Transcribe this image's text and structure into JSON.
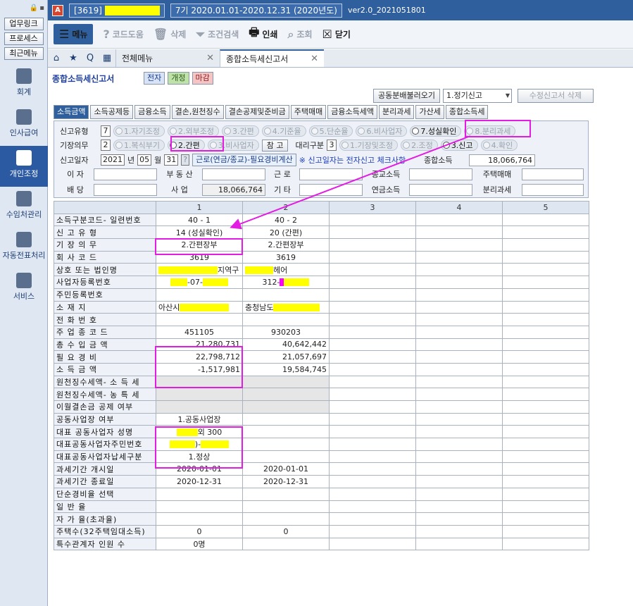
{
  "sidebar": {
    "quick": [
      "업무링크",
      "프로세스",
      "최근메뉴"
    ],
    "nav": [
      {
        "label": "회계",
        "icon": "calculator-icon",
        "active": false
      },
      {
        "label": "인사급여",
        "icon": "person-money-icon",
        "active": false
      },
      {
        "label": "개인조정",
        "icon": "person-icon",
        "active": true
      },
      {
        "label": "수임처관리",
        "icon": "building-icon",
        "active": false
      },
      {
        "label": "자동전표처리",
        "icon": "database-icon",
        "active": false
      },
      {
        "label": "서비스",
        "icon": "monitor-icon",
        "active": false
      }
    ]
  },
  "titlebar": {
    "company_code": "[3619]",
    "period": "7기 2020.01.01-2020.12.31 (2020년도)",
    "version": "ver2.0_2021051801"
  },
  "toolbar": {
    "menu": "메뉴",
    "help": "코드도움",
    "delete": "삭제",
    "search_condition": "조건검색",
    "print": "인쇄",
    "lookup": "조회",
    "close": "닫기"
  },
  "tabs": {
    "main_menu": "전체메뉴",
    "active": "종합소득세신고서"
  },
  "form": {
    "title": "종합소득세신고서",
    "badges": [
      "전자",
      "개정",
      "마감"
    ],
    "joint_button": "공동분배불러오기",
    "filing_select": "1.정기신고",
    "delete_amend": "수정신고서 삭제"
  },
  "subtabs": [
    "소득금액",
    "소득공제등",
    "금융소득",
    "결손,원천징수",
    "결손공제및준비금",
    "주택매매",
    "금융소득세액",
    "분리과세",
    "가산세",
    "종합소득세"
  ],
  "options": {
    "filing_type_label": "신고유형",
    "filing_type_value": "7",
    "filing_types": [
      "1.자기조정",
      "2.외부조정",
      "3.간편",
      "4.기준율",
      "5.단순율",
      "6.비사업자",
      "7.성실확인",
      "8.분리과세"
    ],
    "bookkeeping_label": "기장의무",
    "bookkeeping_value": "2",
    "bookkeeping": [
      "1.복식부기",
      "2.간편",
      "3.비사업자"
    ],
    "ref_button": "참 고",
    "agent_label": "대리구분",
    "agent_value": "3",
    "agent": [
      "1.기장및조정",
      "2.조정",
      "3.신고",
      "4.확인"
    ],
    "filing_date_label": "신고일자",
    "year": "2021",
    "year_unit": "년",
    "month": "05",
    "month_unit": "월",
    "day": "31",
    "help_q": "?",
    "expense_button": "근로(연금/종교)-필요경비계산",
    "note": "※ 신고일자는 전자신고 체크사항",
    "total_income_label": "종합소득",
    "total_income_value": "18,066,764",
    "interest_label": "이 자",
    "real_estate_label": "부 동 산",
    "labor_label": "근 로",
    "religion_label": "종교소득",
    "house_label": "주택매매",
    "dividend_label": "배 당",
    "business_label": "사 업",
    "business_value": "18,066,764",
    "other_label": "기 타",
    "pension_label": "연금소득",
    "separate_label": "분리과세"
  },
  "grid": {
    "columns": [
      "",
      "1",
      "2",
      "3",
      "4",
      "5"
    ],
    "rows": [
      {
        "label": "소득구분코드- 일련번호",
        "c1": "40 - 1",
        "c2": "40 - 2"
      },
      {
        "label": "신 고 유 형",
        "c1": "14 (성실확인)",
        "c2": "20 (간편)"
      },
      {
        "label": "기 장 의 무",
        "c1": "2.간편장부",
        "c2": "2.간편장부"
      },
      {
        "label": "회 사 코 드",
        "c1": "3619",
        "c2": "3619"
      },
      {
        "label": "상호 또는 법인명",
        "c1": "지역구",
        "c2": "헤어"
      },
      {
        "label": "사업자등록번호",
        "c1": "-07-",
        "c2": "312-"
      },
      {
        "label": "주민등록번호",
        "c1": "",
        "c2": ""
      },
      {
        "label": "소 재 지",
        "c1": "아산시",
        "c2": "충청남도"
      },
      {
        "label": "전 화 번 호",
        "c1": "",
        "c2": ""
      },
      {
        "label": "주 업 종 코 드",
        "c1": "451105",
        "c2": "930203"
      },
      {
        "label": "총 수 입 금 액",
        "c1": "21,280,731",
        "c2": "40,642,442"
      },
      {
        "label": "필 요 경 비",
        "c1": "22,798,712",
        "c2": "21,057,697"
      },
      {
        "label": "소 득 금 액",
        "c1": "-1,517,981",
        "c2": "19,584,745"
      },
      {
        "label": "원천징수세액- 소 득 세",
        "c1": "",
        "c2": ""
      },
      {
        "label": "원천징수세액- 농 특 세",
        "c1": "",
        "c2": ""
      },
      {
        "label": "이월결손금 공제 여부",
        "c1": "",
        "c2": ""
      },
      {
        "label": "공동사업장 여부",
        "c1": "1.공동사업장",
        "c2": ""
      },
      {
        "label": "대표 공동사업자 성명",
        "c1": "외 300",
        "c2": ""
      },
      {
        "label": "대표공동사업자주민번호",
        "c1": ")-",
        "c2": ""
      },
      {
        "label": "대표공동사업자납세구분",
        "c1": "1.정상",
        "c2": ""
      },
      {
        "label": "과세기간 개시일",
        "c1": "2020-01-01",
        "c2": "2020-01-01"
      },
      {
        "label": "과세기간 종료일",
        "c1": "2020-12-31",
        "c2": "2020-12-31"
      },
      {
        "label": "단순경비율 선택",
        "c1": "",
        "c2": ""
      },
      {
        "label": "일 반 율",
        "c1": "",
        "c2": ""
      },
      {
        "label": "자 가 율(초과율)",
        "c1": "",
        "c2": ""
      },
      {
        "label": "주택수(32주택임대소득)",
        "c1": "0",
        "c2": "0"
      },
      {
        "label": "특수관계자 인원 수",
        "c1": "0명",
        "c2": ""
      }
    ]
  },
  "colors": {
    "accent": "#2f5f9c",
    "highlight": "#e21ce2",
    "mask": "#ffff00"
  }
}
